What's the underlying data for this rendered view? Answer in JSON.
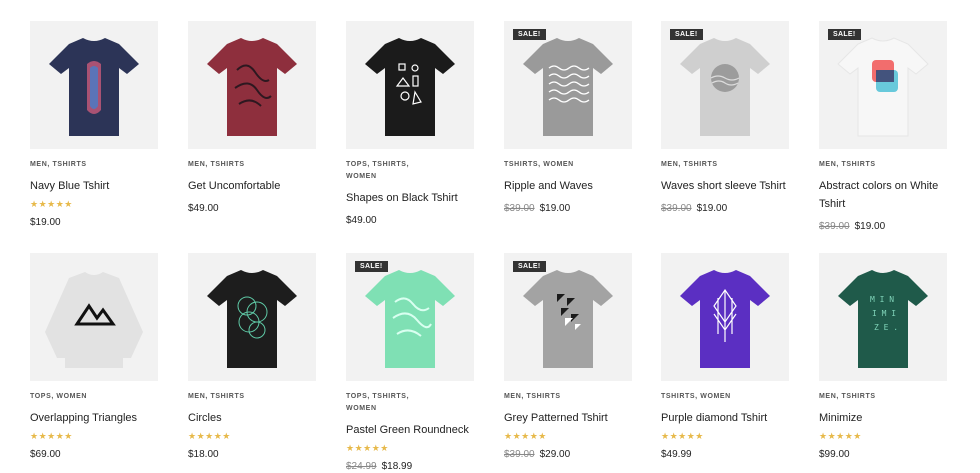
{
  "products": [
    {
      "sale_badge": "",
      "categories": "MEN, TSHIRTS",
      "categories_line2": "",
      "title": "Navy Blue Tshirt",
      "title_line2": "",
      "rating": "★★★★★",
      "old_price": "",
      "price": "$19.00",
      "shirt_color": "#2c3457",
      "stars_value": 5
    },
    {
      "sale_badge": "",
      "categories": "MEN, TSHIRTS",
      "categories_line2": "",
      "title": "Get Uncomfortable",
      "title_line2": "",
      "rating": "",
      "old_price": "",
      "price": "$49.00",
      "shirt_color": "#8e2f3d"
    },
    {
      "sale_badge": "",
      "categories": "TOPS, TSHIRTS,",
      "categories_line2": "WOMEN",
      "title": "Shapes on Black Tshirt",
      "title_line2": "",
      "rating": "",
      "old_price": "",
      "price": "$49.00",
      "shirt_color": "#1b1b1b"
    },
    {
      "sale_badge": "SALE!",
      "categories": "TSHIRTS, WOMEN",
      "categories_line2": "",
      "title": "Ripple and Waves",
      "title_line2": "",
      "rating": "",
      "old_price": "$39.00",
      "price": "$19.00",
      "shirt_color": "#9a9a9a"
    },
    {
      "sale_badge": "SALE!",
      "categories": "MEN, TSHIRTS",
      "categories_line2": "",
      "title": "Waves short sleeve Tshirt",
      "title_line2": "",
      "rating": "",
      "old_price": "$39.00",
      "price": "$19.00",
      "shirt_color": "#cfcfcf"
    },
    {
      "sale_badge": "SALE!",
      "categories": "MEN, TSHIRTS",
      "categories_line2": "",
      "title": "Abstract colors on White",
      "title_line2": "Tshirt",
      "rating": "",
      "old_price": "$39.00",
      "price": "$19.00",
      "shirt_color": "#f7f7f7"
    },
    {
      "sale_badge": "",
      "categories": "TOPS, WOMEN",
      "categories_line2": "",
      "title": "Overlapping Triangles",
      "title_line2": "",
      "rating": "★★★★★",
      "old_price": "",
      "price": "$69.00",
      "shirt_color": "#e2e2e2"
    },
    {
      "sale_badge": "",
      "categories": "MEN, TSHIRTS",
      "categories_line2": "",
      "title": "Circles",
      "title_line2": "",
      "rating": "★★★★★",
      "old_price": "",
      "price": "$18.00",
      "shirt_color": "#1d1d1d"
    },
    {
      "sale_badge": "SALE!",
      "categories": "TOPS, TSHIRTS,",
      "categories_line2": "WOMEN",
      "title": "Pastel Green Roundneck",
      "title_line2": "",
      "rating": "★★★★★",
      "old_price": "$24.99",
      "price": "$18.99",
      "shirt_color": "#7fe0b4"
    },
    {
      "sale_badge": "SALE!",
      "categories": "MEN, TSHIRTS",
      "categories_line2": "",
      "title": "Grey Patterned Tshirt",
      "title_line2": "",
      "rating": "★★★★★",
      "old_price": "$39.00",
      "price": "$29.00",
      "shirt_color": "#a3a3a3"
    },
    {
      "sale_badge": "",
      "categories": "TSHIRTS, WOMEN",
      "categories_line2": "",
      "title": "Purple diamond Tshirt",
      "title_line2": "",
      "rating": "★★★★★",
      "old_price": "",
      "price": "$49.99",
      "shirt_color": "#5b2fc2"
    },
    {
      "sale_badge": "",
      "categories": "MEN, TSHIRTS",
      "categories_line2": "",
      "title": "Minimize",
      "title_line2": "",
      "rating": "★★★★★",
      "old_price": "",
      "price": "$99.00",
      "shirt_color": "#1f5a4a"
    }
  ]
}
